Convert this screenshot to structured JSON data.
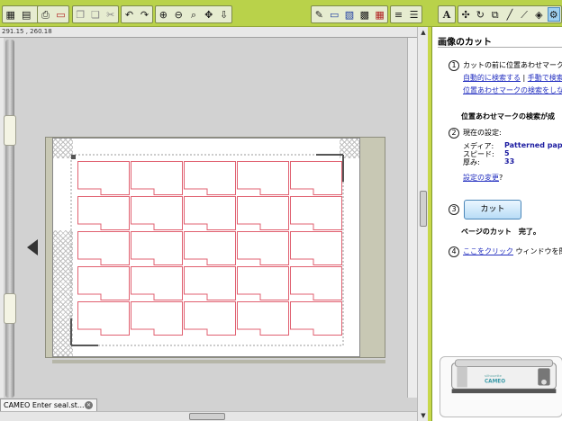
{
  "toolbar": {
    "groups": [
      {
        "icons": [
          "grid-icon",
          "folder-open-icon",
          "save-icon",
          "library-icon"
        ]
      },
      {
        "icons": [
          "printer-icon",
          "cut-icon"
        ]
      },
      {
        "icons": [
          "copy-icon",
          "paste-icon",
          "scissors-icon"
        ]
      },
      {
        "icons": [
          "undo-icon",
          "redo-icon"
        ]
      },
      {
        "icons": [
          "zoom-in-icon",
          "zoom-out-icon",
          "zoom-area-icon",
          "drag-icon",
          "fit-to-page-icon"
        ]
      },
      {
        "icons": [
          "fill-color-icon",
          "line-color-icon",
          "shadow-icon",
          "image-icon",
          "pattern-icon"
        ]
      },
      {
        "icons": [
          "line-style-icon",
          "line-weight-icon"
        ]
      },
      {
        "icons": [
          "text-icon"
        ]
      },
      {
        "icons": [
          "move-icon",
          "rotate-icon",
          "replicate-icon",
          "edit-points-icon",
          "knife-icon",
          "eraser-icon",
          "trace-icon"
        ]
      }
    ]
  },
  "ruler": {
    "coordinate_readout": "291.15 , 260.18"
  },
  "document_tab": {
    "label": "CAMEO Enter seal.st..."
  },
  "colors": {
    "toolbar_bg": "#b9d24a",
    "cut_line": "#e06070",
    "registration": "#555555",
    "link": "#2430c0",
    "value_blue": "#1a1aa0"
  },
  "cut_grid": {
    "rows": 5,
    "columns": 5
  },
  "panel": {
    "title": "画像のカット",
    "step1": {
      "number": "1",
      "text": "カットの前に位置あわせマークの",
      "link_auto": "自動的に検索する",
      "separator": "|",
      "link_manual": "手動で検索",
      "link_no_search": "位置あわせマークの検索をしない"
    },
    "status_text": "位置あわせマークの検索が成",
    "step2": {
      "number": "2",
      "label": "現在の設定:",
      "media_label": "メディア:",
      "media_value": "Patterned paper",
      "speed_label": "スピード:",
      "speed_value": "5",
      "thickness_label": "厚み:",
      "thickness_value": "33",
      "change_link": "設定の変更",
      "change_suffix": "?"
    },
    "step3": {
      "number": "3",
      "cut_button": "カット",
      "cut_status": "ページのカット　完了。"
    },
    "step4": {
      "number": "4",
      "link": "ここをクリック",
      "text": "ウィンドウを閉じる"
    },
    "machine_brand": "CAMEO",
    "machine_maker": "silhouette"
  }
}
